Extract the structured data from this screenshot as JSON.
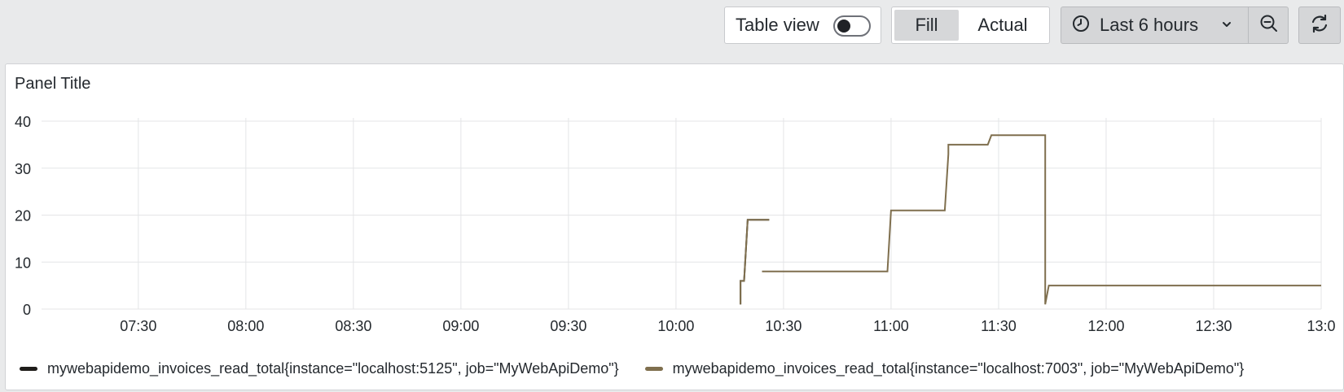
{
  "toolbar": {
    "table_view_label": "Table view",
    "table_view_on": false,
    "fill_label": "Fill",
    "actual_label": "Actual",
    "time_range_label": "Last 6 hours",
    "icons": {
      "clock": "clock-icon",
      "chevron": "chevron-down-icon",
      "zoom_out": "zoom-out-icon",
      "refresh": "refresh-icon"
    }
  },
  "panel": {
    "title": "Panel Title"
  },
  "chart_data": {
    "type": "line",
    "title": "Panel Title",
    "xlabel": "",
    "ylabel": "",
    "x_range": [
      "07:03",
      "13:00"
    ],
    "ylim": [
      0,
      40
    ],
    "yticks": [
      0,
      10,
      20,
      30,
      40
    ],
    "xticks": [
      "07:30",
      "08:00",
      "08:30",
      "09:00",
      "09:30",
      "10:00",
      "10:30",
      "11:00",
      "11:30",
      "12:00",
      "12:30",
      "13:0"
    ],
    "grid": true,
    "legend_position": "bottom-left",
    "series": [
      {
        "name": "mywebapidemo_invoices_read_total{instance=\"localhost:5125\", job=\"MyWebApiDemo\"}",
        "color": "#1f1d1a",
        "segments": [
          [
            [
              "10:18",
              1
            ],
            [
              "10:18",
              6
            ],
            [
              "10:19",
              6
            ],
            [
              "10:20",
              19
            ],
            [
              "10:26",
              19
            ]
          ]
        ]
      },
      {
        "name": "mywebapidemo_invoices_read_total{instance=\"localhost:7003\", job=\"MyWebApiDemo\"}",
        "color": "#7f6f4e",
        "segments": [
          [
            [
              "10:18",
              1
            ],
            [
              "10:18",
              6
            ],
            [
              "10:19",
              6
            ],
            [
              "10:20",
              19
            ],
            [
              "10:26",
              19
            ]
          ],
          [
            [
              "10:24",
              8
            ],
            [
              "10:59",
              8
            ],
            [
              "11:00",
              21
            ],
            [
              "11:15",
              21
            ],
            [
              "11:16",
              33
            ],
            [
              "11:16",
              35
            ],
            [
              "11:27",
              35
            ],
            [
              "11:28",
              37
            ],
            [
              "11:43",
              37
            ],
            [
              "11:43",
              1
            ],
            [
              "11:44",
              5
            ],
            [
              "13:00",
              5
            ]
          ]
        ]
      }
    ]
  }
}
